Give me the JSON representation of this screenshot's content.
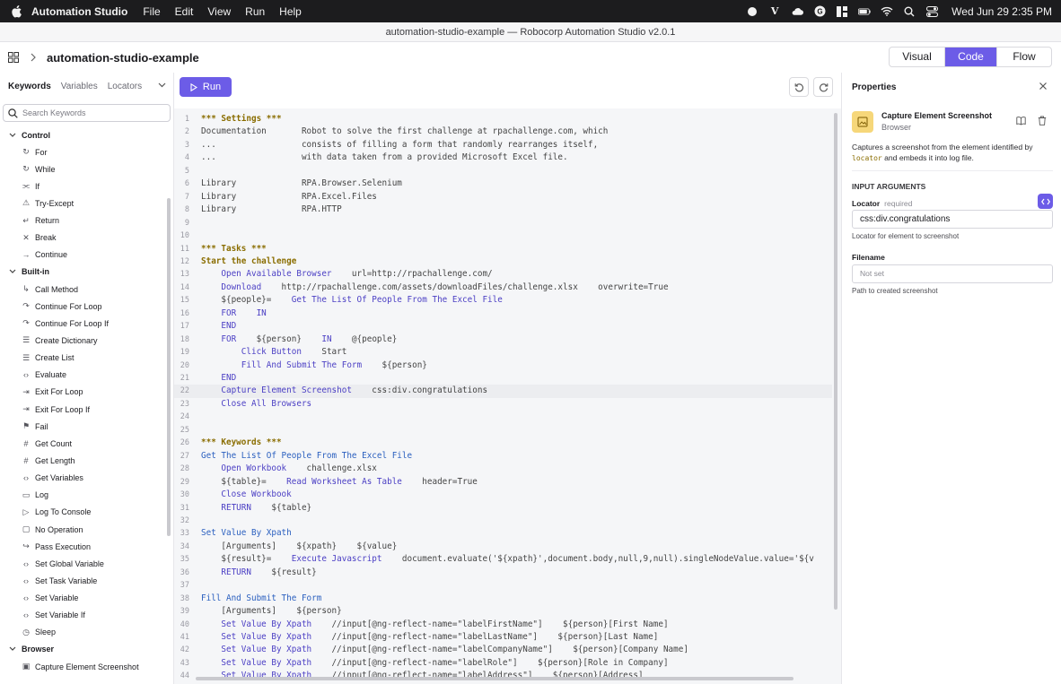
{
  "menubar": {
    "app_name": "Automation Studio",
    "menus": [
      "File",
      "Edit",
      "View",
      "Run",
      "Help"
    ],
    "clock": "Wed Jun 29  2:35 PM"
  },
  "window": {
    "title": "automation-studio-example — Robocorp Automation Studio v2.0.1"
  },
  "header": {
    "project": "automation-studio-example",
    "views": [
      "Visual",
      "Code",
      "Flow"
    ],
    "active_view": "Code"
  },
  "sidebar": {
    "tabs": [
      "Keywords",
      "Variables",
      "Locators"
    ],
    "active_tab": "Keywords",
    "search_placeholder": "Search Keywords",
    "groups": [
      {
        "name": "Control",
        "items": [
          {
            "label": "For",
            "icon": "loop-icon"
          },
          {
            "label": "While",
            "icon": "loop-icon"
          },
          {
            "label": "If",
            "icon": "branch-icon"
          },
          {
            "label": "Try-Except",
            "icon": "warning-icon"
          },
          {
            "label": "Return",
            "icon": "return-icon"
          },
          {
            "label": "Break",
            "icon": "cross-icon"
          },
          {
            "label": "Continue",
            "icon": "arrow-right-icon"
          }
        ]
      },
      {
        "name": "Built-in",
        "items": [
          {
            "label": "Call Method",
            "icon": "call-icon"
          },
          {
            "label": "Continue For Loop",
            "icon": "skip-icon"
          },
          {
            "label": "Continue For Loop If",
            "icon": "skip-icon"
          },
          {
            "label": "Create Dictionary",
            "icon": "list-icon"
          },
          {
            "label": "Create List",
            "icon": "list-icon"
          },
          {
            "label": "Evaluate",
            "icon": "code-icon"
          },
          {
            "label": "Exit For Loop",
            "icon": "exit-icon"
          },
          {
            "label": "Exit For Loop If",
            "icon": "exit-icon"
          },
          {
            "label": "Fail",
            "icon": "flag-icon"
          },
          {
            "label": "Get Count",
            "icon": "hash-icon"
          },
          {
            "label": "Get Length",
            "icon": "hash-icon"
          },
          {
            "label": "Get Variables",
            "icon": "variable-icon"
          },
          {
            "label": "Log",
            "icon": "log-icon"
          },
          {
            "label": "Log To Console",
            "icon": "terminal-icon"
          },
          {
            "label": "No Operation",
            "icon": "empty-icon"
          },
          {
            "label": "Pass Execution",
            "icon": "pass-icon"
          },
          {
            "label": "Set Global Variable",
            "icon": "variable-icon"
          },
          {
            "label": "Set Task Variable",
            "icon": "variable-icon"
          },
          {
            "label": "Set Variable",
            "icon": "variable-icon"
          },
          {
            "label": "Set Variable If",
            "icon": "variable-icon"
          },
          {
            "label": "Sleep",
            "icon": "clock-icon"
          }
        ]
      },
      {
        "name": "Browser",
        "items": [
          {
            "label": "Capture Element Screenshot",
            "icon": "image-icon"
          }
        ]
      }
    ]
  },
  "editor": {
    "run_label": "Run",
    "highlight_line": 22,
    "lines": [
      [
        [
          "c-sect",
          "*** Settings ***"
        ]
      ],
      [
        [
          "c-plain",
          "Documentation       Robot to solve the first challenge at rpachallenge.com, which"
        ]
      ],
      [
        [
          "c-plain",
          "...                 consists of filling a form that randomly rearranges itself,"
        ]
      ],
      [
        [
          "c-plain",
          "...                 with data taken from a provided Microsoft Excel file."
        ]
      ],
      [],
      [
        [
          "c-plain",
          "Library             RPA.Browser.Selenium"
        ]
      ],
      [
        [
          "c-plain",
          "Library             RPA.Excel.Files"
        ]
      ],
      [
        [
          "c-plain",
          "Library             RPA.HTTP"
        ]
      ],
      [],
      [],
      [
        [
          "c-sect",
          "*** Tasks ***"
        ]
      ],
      [
        [
          "c-sect",
          "Start the challenge"
        ]
      ],
      [
        [
          "c-plain",
          "    "
        ],
        [
          "c-call",
          "Open Available Browser"
        ],
        [
          "c-plain",
          "    url=http://rpachallenge.com/"
        ]
      ],
      [
        [
          "c-plain",
          "    "
        ],
        [
          "c-call",
          "Download"
        ],
        [
          "c-plain",
          "    http://rpachallenge.com/assets/downloadFiles/challenge.xlsx    overwrite=True"
        ]
      ],
      [
        [
          "c-plain",
          "    ${people}=    "
        ],
        [
          "c-call",
          "Get The List Of People From The Excel File"
        ]
      ],
      [
        [
          "c-plain",
          "    "
        ],
        [
          "c-call",
          "FOR"
        ],
        [
          "c-plain",
          "    "
        ],
        [
          "c-call",
          "IN"
        ]
      ],
      [
        [
          "c-plain",
          "    "
        ],
        [
          "c-call",
          "END"
        ]
      ],
      [
        [
          "c-plain",
          "    "
        ],
        [
          "c-call",
          "FOR"
        ],
        [
          "c-plain",
          "    ${person}    "
        ],
        [
          "c-call",
          "IN"
        ],
        [
          "c-plain",
          "    @{people}"
        ]
      ],
      [
        [
          "c-plain",
          "        "
        ],
        [
          "c-call",
          "Click Button"
        ],
        [
          "c-plain",
          "    Start"
        ]
      ],
      [
        [
          "c-plain",
          "        "
        ],
        [
          "c-call",
          "Fill And Submit The Form"
        ],
        [
          "c-plain",
          "    ${person}"
        ]
      ],
      [
        [
          "c-plain",
          "    "
        ],
        [
          "c-call",
          "END"
        ]
      ],
      [
        [
          "c-plain",
          "    "
        ],
        [
          "c-call",
          "Capture Element Screenshot"
        ],
        [
          "c-plain",
          "    css:div.congratulations"
        ]
      ],
      [
        [
          "c-plain",
          "    "
        ],
        [
          "c-call",
          "Close All Browsers"
        ]
      ],
      [],
      [],
      [
        [
          "c-sect",
          "*** Keywords ***"
        ]
      ],
      [
        [
          "c-kw",
          "Get The List Of People From The Excel File"
        ]
      ],
      [
        [
          "c-plain",
          "    "
        ],
        [
          "c-call",
          "Open Workbook"
        ],
        [
          "c-plain",
          "    challenge.xlsx"
        ]
      ],
      [
        [
          "c-plain",
          "    ${table}=    "
        ],
        [
          "c-call",
          "Read Worksheet As Table"
        ],
        [
          "c-plain",
          "    header=True"
        ]
      ],
      [
        [
          "c-plain",
          "    "
        ],
        [
          "c-call",
          "Close Workbook"
        ]
      ],
      [
        [
          "c-plain",
          "    "
        ],
        [
          "c-call",
          "RETURN"
        ],
        [
          "c-plain",
          "    ${table}"
        ]
      ],
      [],
      [
        [
          "c-kw",
          "Set Value By Xpath"
        ]
      ],
      [
        [
          "c-plain",
          "    [Arguments]    ${xpath}    ${value}"
        ]
      ],
      [
        [
          "c-plain",
          "    ${result}=    "
        ],
        [
          "c-call",
          "Execute Javascript"
        ],
        [
          "c-plain",
          "    document.evaluate('${xpath}',document.body,null,9,null).singleNodeValue.value='${v"
        ]
      ],
      [
        [
          "c-plain",
          "    "
        ],
        [
          "c-call",
          "RETURN"
        ],
        [
          "c-plain",
          "    ${result}"
        ]
      ],
      [],
      [
        [
          "c-kw",
          "Fill And Submit The Form"
        ]
      ],
      [
        [
          "c-plain",
          "    [Arguments]    ${person}"
        ]
      ],
      [
        [
          "c-plain",
          "    "
        ],
        [
          "c-call",
          "Set Value By Xpath"
        ],
        [
          "c-plain",
          "    //input[@ng-reflect-name=\"labelFirstName\"]    ${person}[First Name]"
        ]
      ],
      [
        [
          "c-plain",
          "    "
        ],
        [
          "c-call",
          "Set Value By Xpath"
        ],
        [
          "c-plain",
          "    //input[@ng-reflect-name=\"labelLastName\"]    ${person}[Last Name]"
        ]
      ],
      [
        [
          "c-plain",
          "    "
        ],
        [
          "c-call",
          "Set Value By Xpath"
        ],
        [
          "c-plain",
          "    //input[@ng-reflect-name=\"labelCompanyName\"]    ${person}[Company Name]"
        ]
      ],
      [
        [
          "c-plain",
          "    "
        ],
        [
          "c-call",
          "Set Value By Xpath"
        ],
        [
          "c-plain",
          "    //input[@ng-reflect-name=\"labelRole\"]    ${person}[Role in Company]"
        ]
      ],
      [
        [
          "c-plain",
          "    "
        ],
        [
          "c-call",
          "Set Value By Xpath"
        ],
        [
          "c-plain",
          "    //input[@ng-reflect-name=\"labelAddress\"]    ${person}[Address]"
        ]
      ]
    ]
  },
  "properties": {
    "title": "Properties",
    "keyword_name": "Capture Element Screenshot",
    "keyword_library": "Browser",
    "description_pre": "Captures a screenshot from the element identified by ",
    "description_code": "locator",
    "description_post": " and embeds it into log file.",
    "section": "INPUT ARGUMENTS",
    "locator_label": "Locator",
    "locator_required": "required",
    "locator_value": "css:div.congratulations",
    "locator_hint": "Locator for element to screenshot",
    "filename_label": "Filename",
    "filename_placeholder": "Not set",
    "filename_hint": "Path to created screenshot"
  }
}
